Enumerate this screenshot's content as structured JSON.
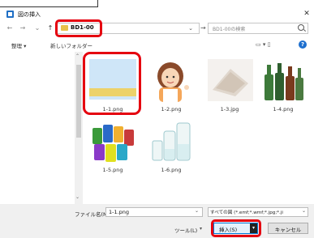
{
  "window": {
    "title": "図の挿入",
    "close_glyph": "✕"
  },
  "nav": {
    "back": "←",
    "forward": "→",
    "recent": "⌄",
    "up": "↑"
  },
  "address": {
    "folder": "BD1-00",
    "dropdown": "⌄",
    "go": "→"
  },
  "search": {
    "placeholder": "BD1-00の検索"
  },
  "toolbar": {
    "organize": "整理 ▾",
    "new_folder": "新しいフォルダー",
    "view_icons": "▭ ▾  ▯",
    "help": "?"
  },
  "files": [
    {
      "name": "1-1.png",
      "selected": true
    },
    {
      "name": "1-2.png"
    },
    {
      "name": "1-3.jpg"
    },
    {
      "name": "1-4.png"
    },
    {
      "name": "1-5.png"
    },
    {
      "name": "1-6.png"
    }
  ],
  "bottom": {
    "filename_label": "ファイル名(N):",
    "filename_value": "1-1.png",
    "filetype_value": "すべての図 (*.emf;*.wmf;*.jpg;*.ji",
    "tools_label": "ツール(L)",
    "insert_label": "挿入(S)",
    "cancel_label": "キャンセル"
  },
  "colors": {
    "highlight": "#e5000f",
    "accent": "#0078d7"
  }
}
